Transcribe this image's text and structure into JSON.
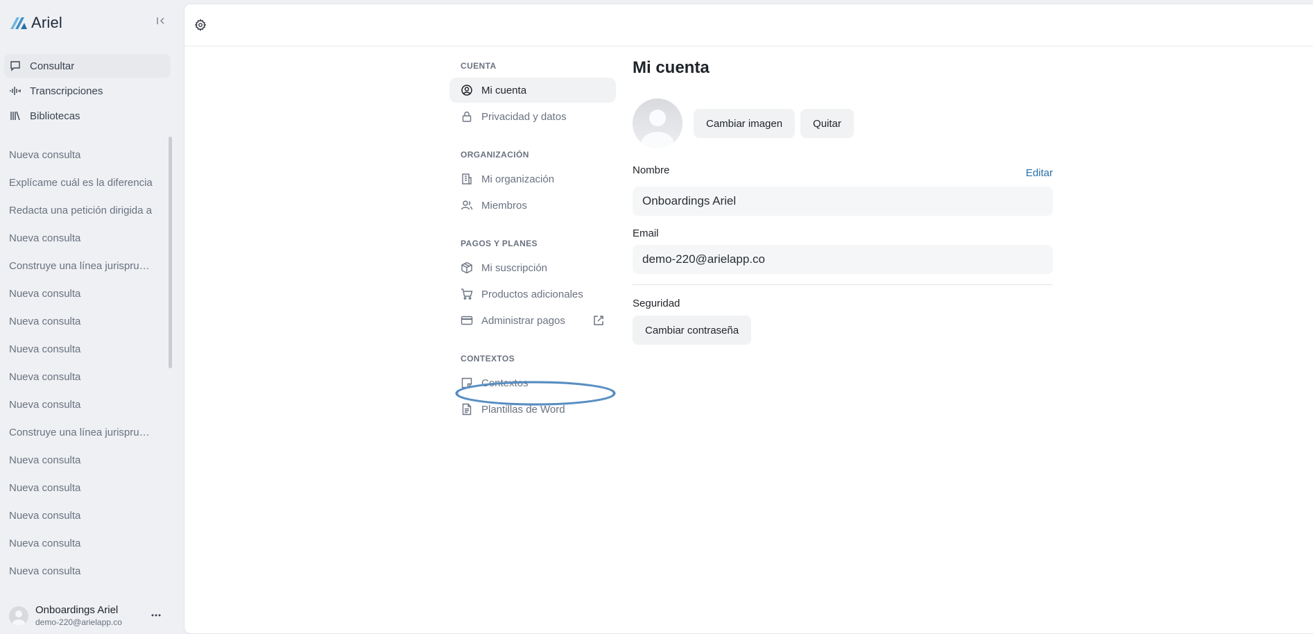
{
  "app": {
    "name": "Ariel"
  },
  "sidebar": {
    "nav": [
      {
        "label": "Consultar",
        "icon": "chat-bubble-icon"
      },
      {
        "label": "Transcripciones",
        "icon": "waveform-icon"
      },
      {
        "label": "Bibliotecas",
        "icon": "library-icon"
      }
    ],
    "history": [
      "Nueva consulta",
      "Explícame cuál es la diferencia",
      "Redacta una petición dirigida a",
      "Nueva consulta",
      "Construye una línea jurisprudencial",
      "Nueva consulta",
      "Nueva consulta",
      "Nueva consulta",
      "Nueva consulta",
      "Nueva consulta",
      "Construye una línea jurisprudencial",
      "Nueva consulta",
      "Nueva consulta",
      "Nueva consulta",
      "Nueva consulta",
      "Nueva consulta"
    ],
    "user": {
      "name": "Onboardings Ariel",
      "email": "demo-220@arielapp.co"
    }
  },
  "settings_nav": {
    "sections": [
      {
        "label": "CUENTA",
        "items": [
          "Mi cuenta",
          "Privacidad y datos"
        ]
      },
      {
        "label": "ORGANIZACIÓN",
        "items": [
          "Mi organización",
          "Miembros"
        ]
      },
      {
        "label": "PAGOS Y PLANES",
        "items": [
          "Mi suscripción",
          "Productos adicionales",
          "Administrar pagos"
        ]
      },
      {
        "label": "CONTEXTOS",
        "items": [
          "Contextos",
          "Plantillas de Word"
        ]
      }
    ],
    "active": "Mi cuenta",
    "highlighted": "Plantillas de Word"
  },
  "account": {
    "title": "Mi cuenta",
    "change_image": "Cambiar imagen",
    "remove": "Quitar",
    "name_label": "Nombre",
    "edit": "Editar",
    "name_value": "Onboardings Ariel",
    "email_label": "Email",
    "email_value": "demo-220@arielapp.co",
    "security_label": "Seguridad",
    "change_password": "Cambiar contraseña"
  },
  "colors": {
    "accent": "#2a6fa8",
    "annotation": "#4f86bd",
    "logo": "#5aa9d6"
  }
}
